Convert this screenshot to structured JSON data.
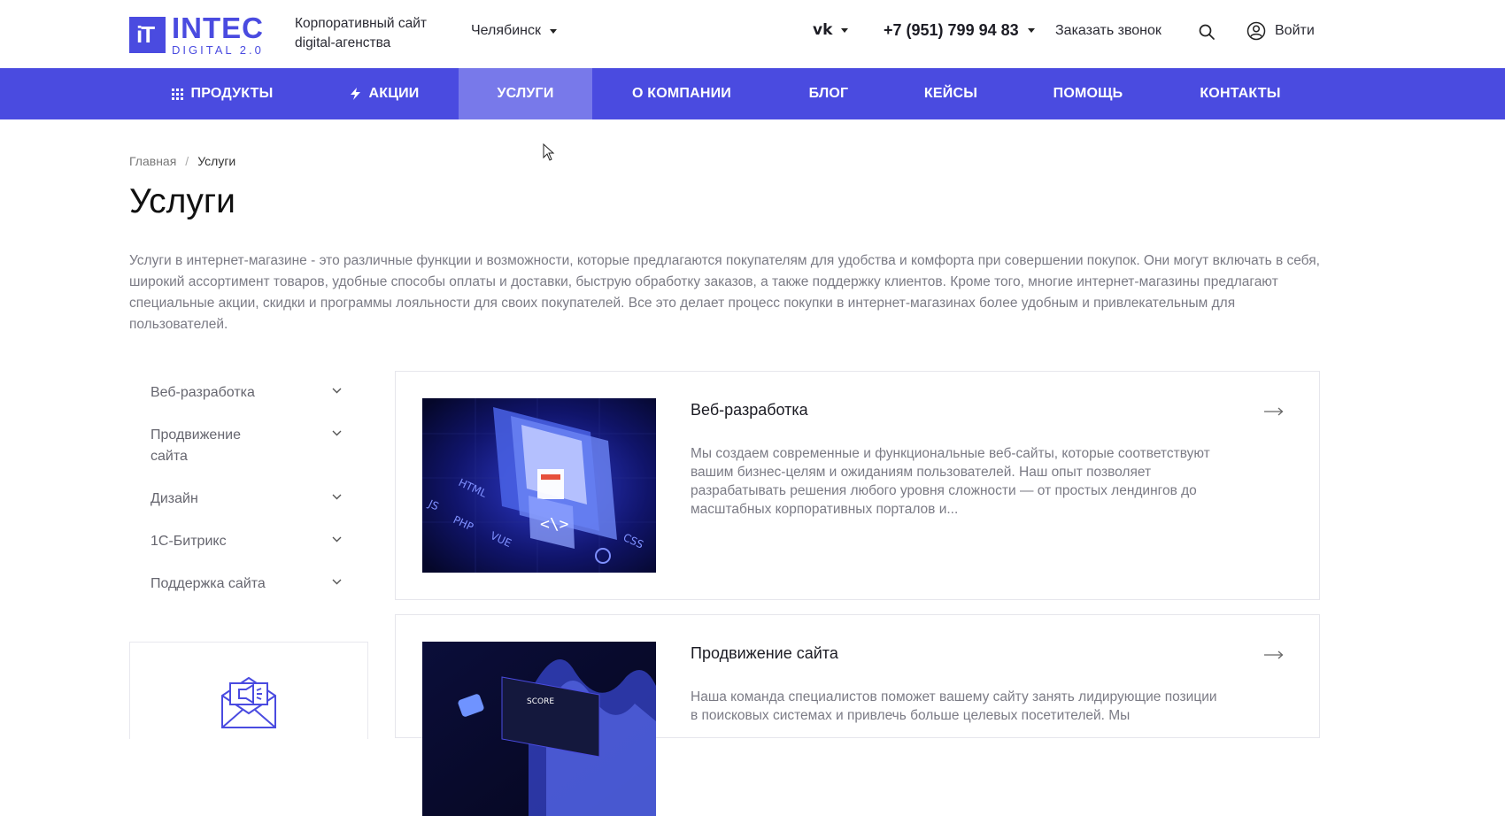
{
  "header": {
    "logo_name": "INTEC",
    "logo_sub": "DIGITAL 2.0",
    "logo_mark": "iT",
    "tagline": "Корпоративный сайт digital-агенства",
    "city": "Челябинск",
    "social": "vk",
    "phone": "+7 (951) 799 94 83",
    "callback": "Заказать звонок",
    "login": "Войти"
  },
  "nav": {
    "items": [
      {
        "label": "ПРОДУКТЫ",
        "icon": "grid-icon"
      },
      {
        "label": "АКЦИИ",
        "icon": "lightning-icon"
      },
      {
        "label": "УСЛУГИ",
        "active": true
      },
      {
        "label": "О КОМПАНИИ"
      },
      {
        "label": "БЛОГ"
      },
      {
        "label": "КЕЙСЫ"
      },
      {
        "label": "ПОМОЩЬ"
      },
      {
        "label": "КОНТАКТЫ"
      }
    ]
  },
  "breadcrumb": {
    "home": "Главная",
    "separator": "/",
    "current": "Услуги"
  },
  "page": {
    "title": "Услуги",
    "intro": "Услуги в интернет-магазине - это различные функции и возможности, которые предлагаются покупателям для удобства и комфорта при совершении покупок. Они могут включать в себя, широкий ассортимент товаров, удобные способы оплаты и доставки, быструю обработку заказов, а также поддержку клиентов. Кроме того, многие интернет-магазины предлагают специальные акции, скидки и программы лояльности для своих покупателей. Все это делает процесс покупки в интернет-магазинах более удобным и привлекательным для пользователей."
  },
  "sidebar": {
    "items": [
      {
        "label": "Веб-разработка"
      },
      {
        "label": "Продвижение сайта"
      },
      {
        "label": "Дизайн"
      },
      {
        "label": "1С-Битрикс"
      },
      {
        "label": "Поддержка сайта"
      }
    ]
  },
  "services": [
    {
      "title": "Веб-разработка",
      "description": "Мы создаем современные и функциональные веб-сайты, которые соответствуют вашим бизнес-целям и ожиданиям пользователей. Наш опыт позволяет разрабатывать решения любого уровня сложности — от простых лендингов до масштабных корпоративных порталов и...",
      "image_tags": [
        "HTML",
        "JS",
        "PHP",
        "VUE",
        "CSS"
      ]
    },
    {
      "title": "Продвижение сайта",
      "description": "Наша команда специалистов поможет вашему сайту занять лидирующие позиции в поисковых системах и привлечь больше целевых посетителей. Мы",
      "image_label": "SCORE"
    }
  ],
  "colors": {
    "brand": "#4a4be0",
    "nav_active": "#7879ea",
    "muted_text": "#7b7b85"
  }
}
